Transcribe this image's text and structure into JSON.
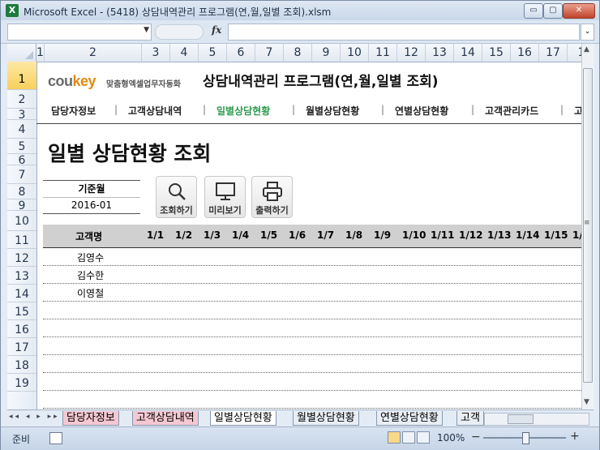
{
  "window": {
    "title": "Microsoft Excel - (5418) 상담내역관리 프로그램(연,월,일별 조회).xlsm",
    "app_icon_letter": "X",
    "min_glyph": "▭",
    "max_glyph": "▢",
    "close_glyph": "✕"
  },
  "formula_bar": {
    "name_box": "",
    "fx_label": "fx",
    "formula": ""
  },
  "columns": [
    "1",
    "2",
    "3",
    "4",
    "5",
    "6",
    "7",
    "8",
    "9",
    "10",
    "11",
    "12",
    "13",
    "14",
    "15",
    "16",
    "17",
    "1"
  ],
  "rows": [
    "1",
    "2",
    "3",
    "4",
    "5",
    "6",
    "7",
    "8",
    "9",
    "10",
    "11",
    "12",
    "13",
    "14",
    "15",
    "16",
    "17",
    "18",
    "19"
  ],
  "brand": {
    "co": "cou",
    "key": "key",
    "sub": "맞춤형엑셀업무자동화"
  },
  "app_title": "상담내역관리 프로그램(연,월,일별 조회)",
  "nav": {
    "items": [
      "담당자정보",
      "고객상담내역",
      "일별상담현황",
      "월별상담현황",
      "연별상담현황",
      "고객관리카드",
      "고"
    ],
    "active": "일별상담현황"
  },
  "page_title": "일별 상담현황 조회",
  "base": {
    "label": "기준월",
    "value": "2016-01"
  },
  "buttons": {
    "search": "조회하기",
    "preview": "미리보기",
    "print": "출력하기"
  },
  "table": {
    "name_header": "고객명",
    "days": [
      "1/1",
      "1/2",
      "1/3",
      "1/4",
      "1/5",
      "1/6",
      "1/7",
      "1/8",
      "1/9",
      "1/10",
      "1/11",
      "1/12",
      "1/13",
      "1/14",
      "1/15",
      "1/"
    ],
    "customers": [
      "김영수",
      "김수한",
      "이영철",
      "",
      "",
      "",
      "",
      "",
      ""
    ]
  },
  "tabs": [
    "담당자정보",
    "고객상담내역",
    "일별상담현황",
    "월별상담현황",
    "연별상담현황",
    "고객"
  ],
  "tab_nav": "◂◂ ◂ ▸ ▸▸",
  "status": {
    "ready": "준비",
    "zoom": "100%",
    "minus": "−",
    "plus": "+"
  },
  "colors": {
    "accent_active": "#2f9a50",
    "brand_key": "#e08a12",
    "tab_pink": "#f4c8d3"
  }
}
